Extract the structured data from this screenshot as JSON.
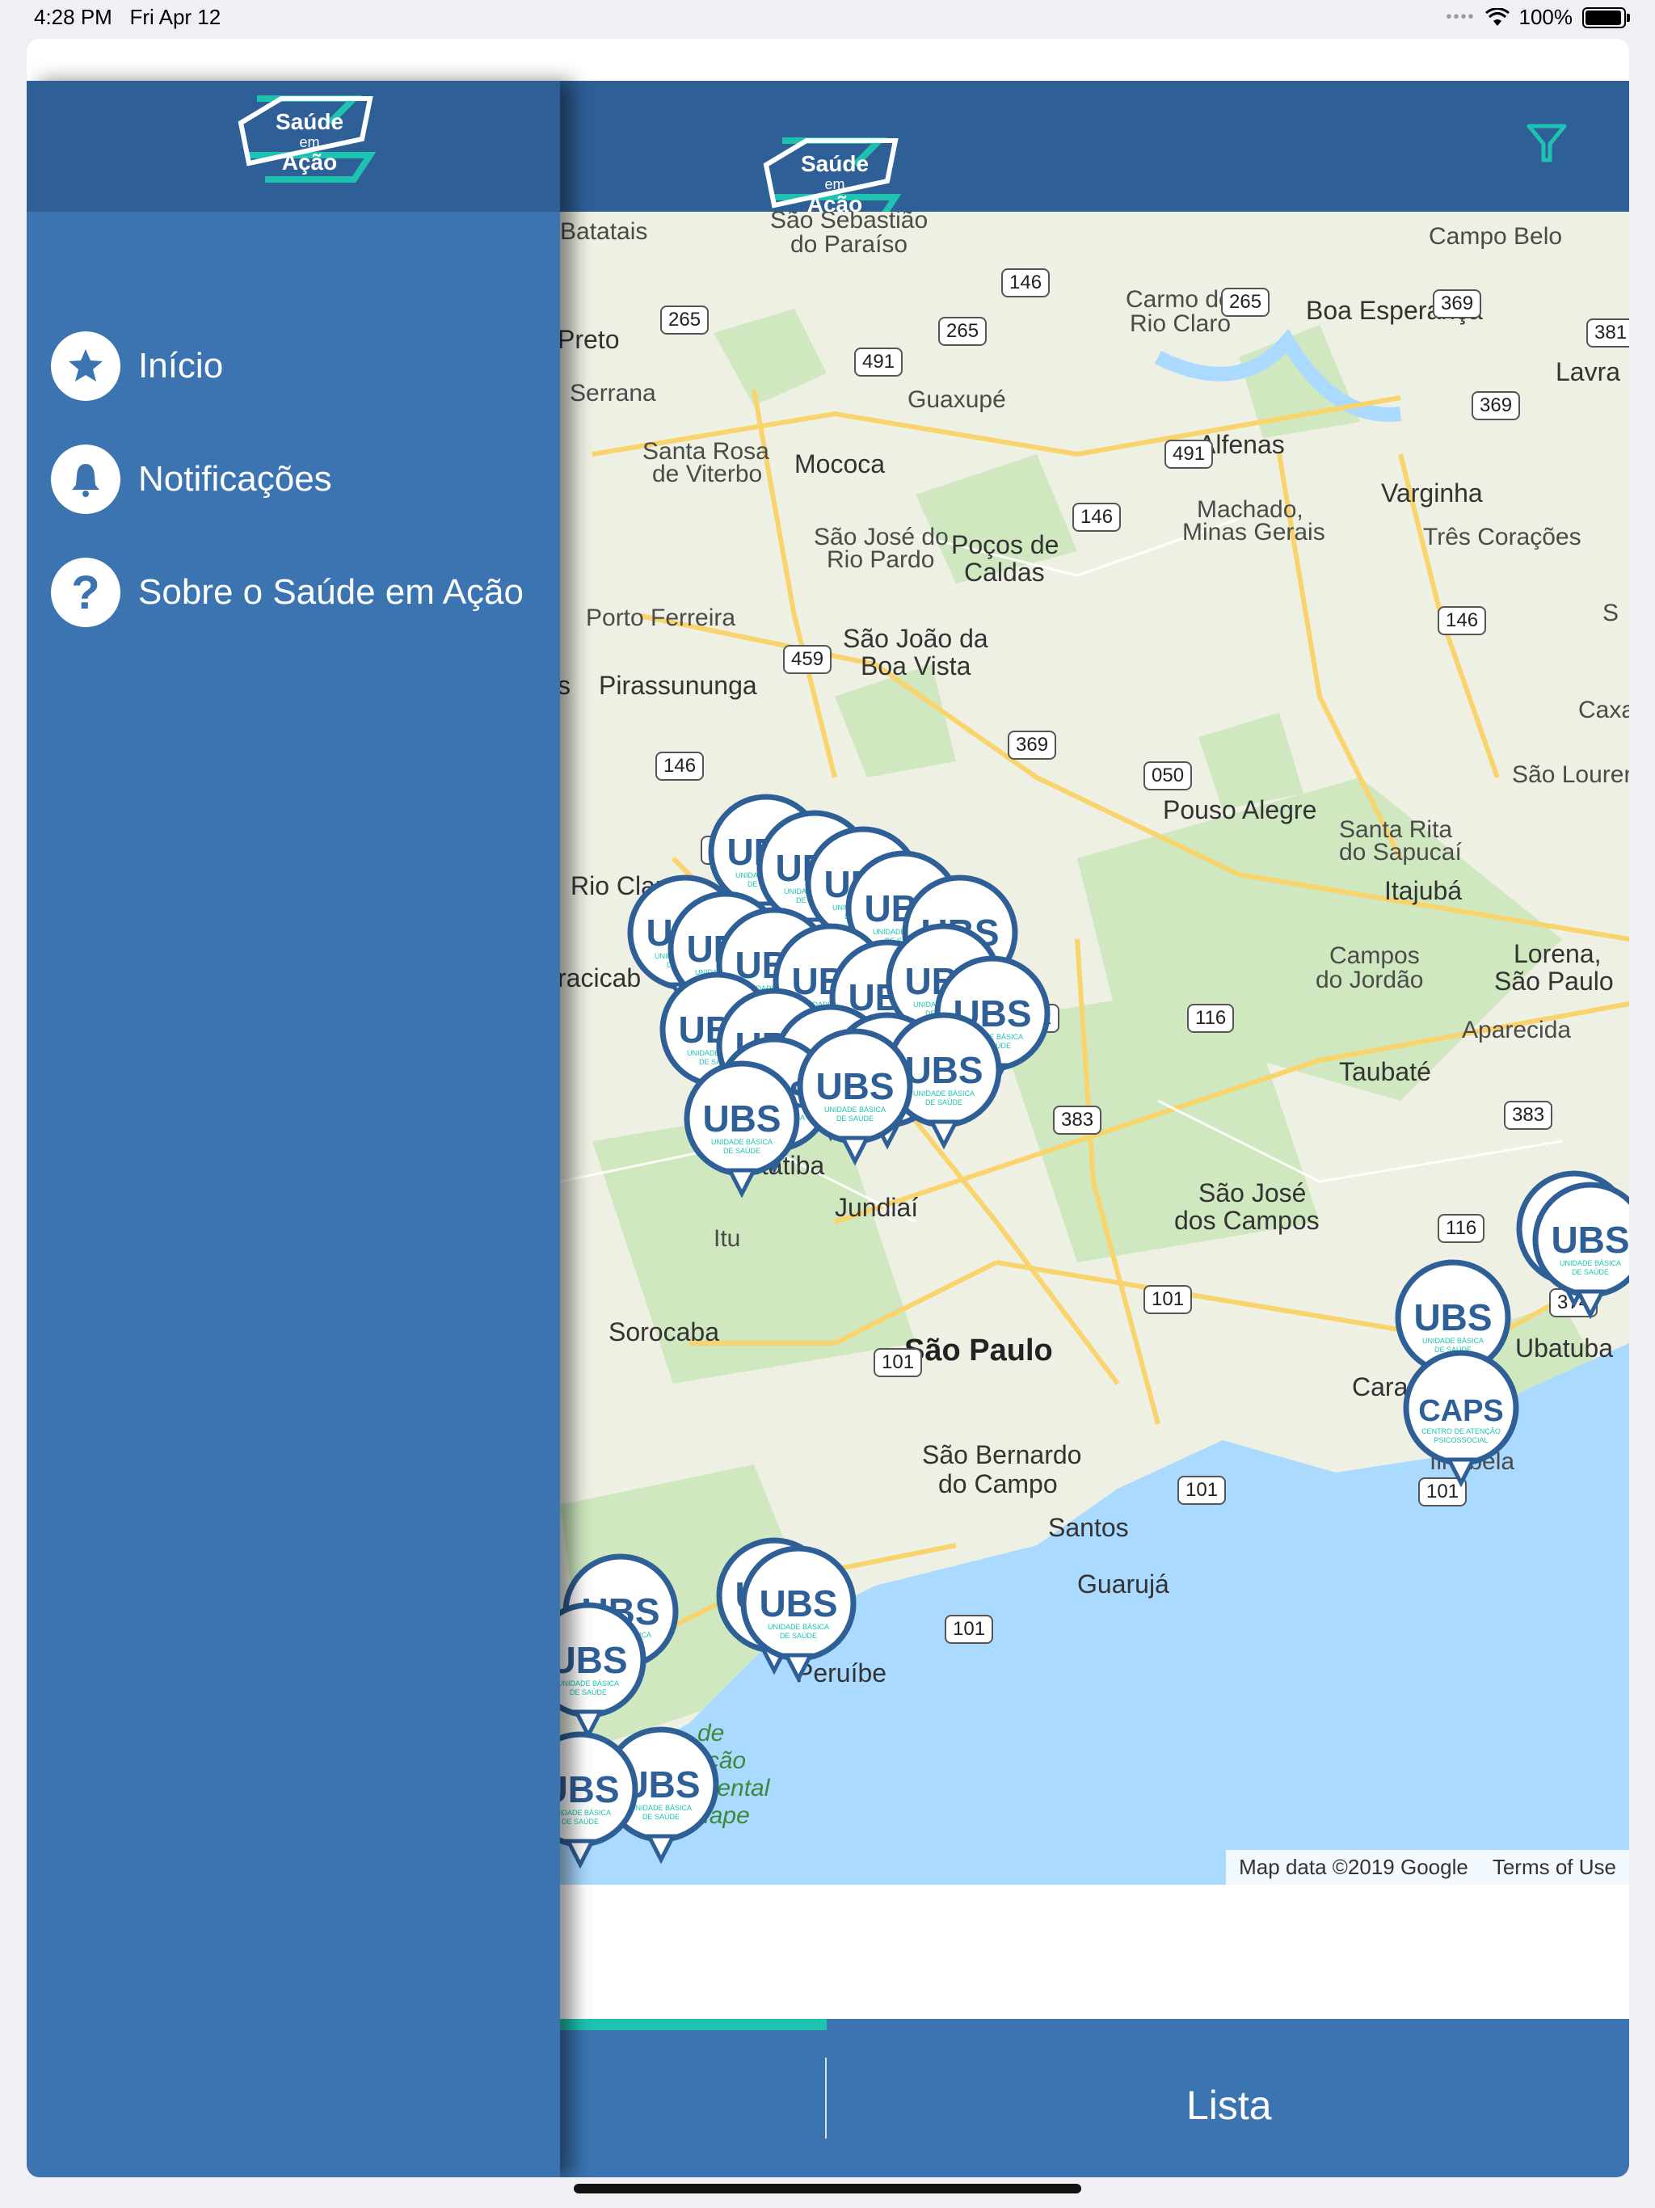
{
  "status_bar": {
    "time": "4:28 PM",
    "date": "Fri Apr 12",
    "battery_percent": "100%",
    "battery_level": 1.0
  },
  "app": {
    "logo_line1": "Saúde",
    "logo_line2": "em",
    "logo_line3": "Ação",
    "brand_color": "#2f5f97",
    "accent_color": "#1ec3b0"
  },
  "drawer": {
    "items": [
      {
        "label": "Início",
        "icon": "star-icon"
      },
      {
        "label": "Notificações",
        "icon": "bell-icon"
      },
      {
        "label": "Sobre o Saúde em Ação",
        "icon": "question-icon"
      }
    ]
  },
  "map": {
    "cities": {
      "batatais": "Batatais",
      "sao_sebastiao": "São Sebastião",
      "do_paraiso": "do Paraíso",
      "campo_belo": "Campo Belo",
      "carmo": "Carmo do",
      "rio_claro_mg": "Rio Claro",
      "boa_esperanca": "Boa Esperança",
      "preto": "Preto",
      "lavra": "Lavra",
      "serrana": "Serrana",
      "guaxupe": "Guaxupé",
      "santa_rosa": "Santa Rosa",
      "de_viterbo": "de Viterbo",
      "mococa": "Mococa",
      "alfenas": "Alfenas",
      "varginha": "Varginha",
      "machado": "Machado,",
      "minas_gerais": "Minas Gerais",
      "sao_jose_rio": "São José do",
      "rio_pardo": "Rio Pardo",
      "pocos": "Poços de",
      "caldas": "Caldas",
      "tres_coracoes": "Três Corações",
      "porto_ferreira": "Porto Ferreira",
      "sao_joao": "São João da",
      "boa_vista": "Boa Vista",
      "pirassununga": "Pirassununga",
      "caxa": "Caxa",
      "sao_louren": "São Louren",
      "pouso_alegre": "Pouso Alegre",
      "santa_rita": "Santa Rita",
      "do_sapucai": "do Sapucaí",
      "rio_claro": "Rio Claro",
      "itajuba": "Itajubá",
      "lorena": "Lorena,",
      "sao_paulo_lorena": "São Paulo",
      "campos": "Campos",
      "do_jordao": "do Jordão",
      "piracicaba": "racicab",
      "aparecida": "Aparecida",
      "taubate": "Taubaté",
      "itatiba": "Itatiba",
      "jundiai": "Jundiaí",
      "sao_jose": "São José",
      "dos_campos": "dos Campos",
      "itu": "Itu",
      "ubatuba": "Ubatuba",
      "sorocaba": "Sorocaba",
      "sao_paulo": "São Paulo",
      "caraguatatuba": "Cara",
      "sao_bernardo": "São Bernardo",
      "do_campo": "do Campo",
      "ilhabela": "Ilhabela",
      "santos": "Santos",
      "guaruja": "Guarujá",
      "peruibe": "Peruíbe",
      "apa_de": "de",
      "apa_protecao": "oteção",
      "apa_ambiental": "Ambiental",
      "apa_iguape": "e Iguape",
      "s_edge": "s",
      "s_right": "S"
    },
    "roads": [
      "146",
      "265",
      "265",
      "265",
      "369",
      "381",
      "491",
      "491",
      "146",
      "369",
      "146",
      "459",
      "369",
      "050",
      "146",
      "381",
      "381",
      "116",
      "383",
      "383",
      "116",
      "374",
      "101",
      "101",
      "101"
    ],
    "pins": {
      "ubs": "UBS",
      "ubs_sub1": "UNIDADE BÁSICA",
      "ubs_sub2": "DE SAÚDE",
      "caps": "CAPS",
      "caps_sub1": "CENTRO DE ATENÇÃO",
      "caps_sub2": "PSICOSSOCIAL"
    },
    "attribution": "Map data ©2019 Google",
    "terms": "Terms of Use"
  },
  "tabs": {
    "list_label": "Lista",
    "active_index": 0
  }
}
